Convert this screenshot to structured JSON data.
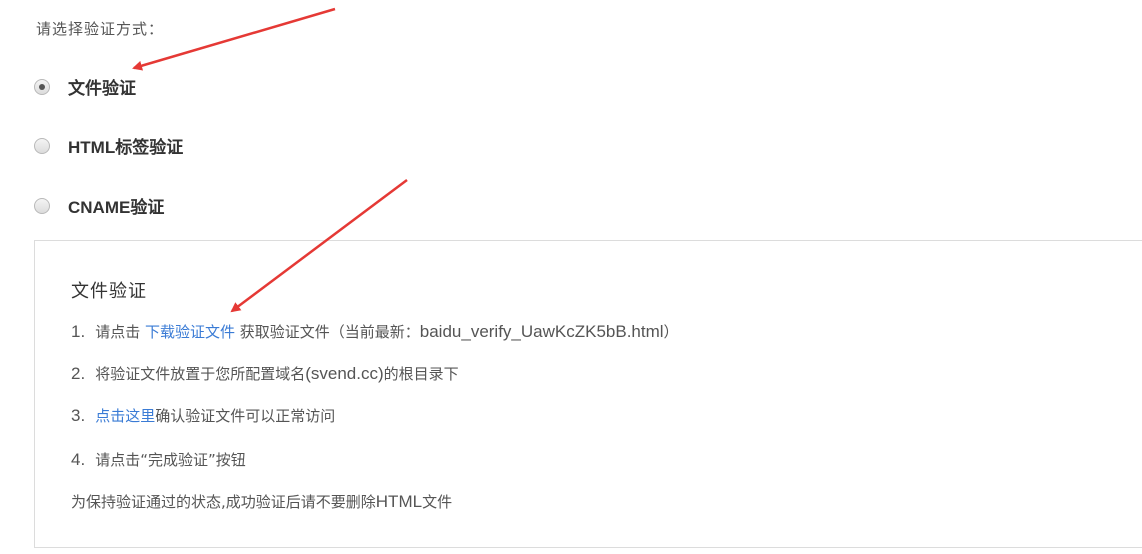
{
  "prompt_label": "请选择验证方式：",
  "options": [
    {
      "label": "文件验证",
      "checked": true
    },
    {
      "label": "HTML标签验证",
      "checked": false
    },
    {
      "label": "CNAME验证",
      "checked": false
    }
  ],
  "panel": {
    "title": "文件验证",
    "steps": [
      {
        "num": "1.",
        "pre": "请点击 ",
        "link": "下载验证文件",
        "mid": " 获取验证文件（当前最新：",
        "file": "baidu_verify_UawKcZK5bB.html",
        "post": "）"
      },
      {
        "num": "2.",
        "pre": "将验证文件放置于您所配置域名",
        "domain": "(svend.cc)",
        "post": "的根目录下"
      },
      {
        "num": "3.",
        "link": "点击这里",
        "post": "确认验证文件可以正常访问"
      },
      {
        "num": "4.",
        "text": "请点击“完成验证”按钮"
      }
    ],
    "note_pre": "为保持验证通过的状态,成功验证后请不要删除",
    "note_html": "HTML",
    "note_post": "文件"
  },
  "colors": {
    "link": "#3a7bd5",
    "arrow": "#e53935",
    "text": "#555555"
  }
}
